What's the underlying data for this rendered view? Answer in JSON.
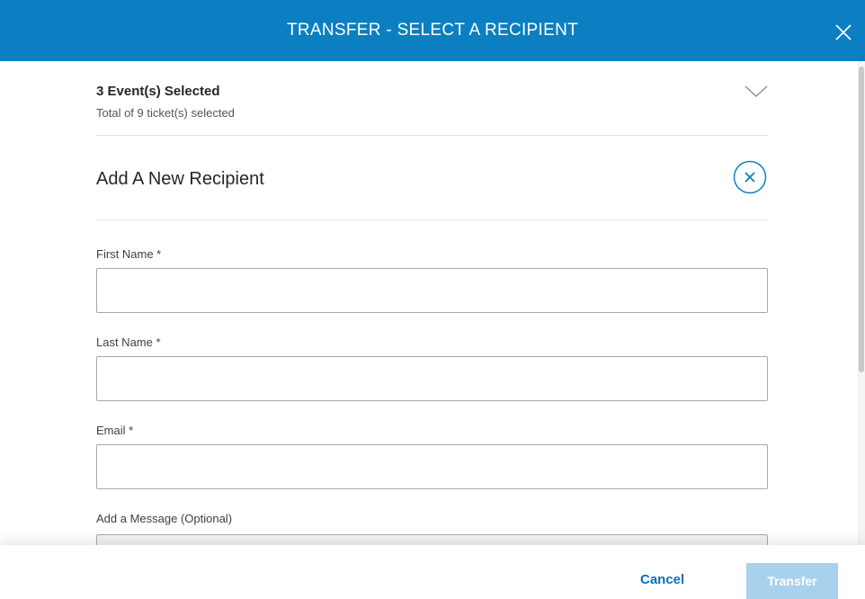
{
  "header": {
    "title": "TRANSFER - SELECT A RECIPIENT",
    "close_icon": "close-icon"
  },
  "events": {
    "title": "3 Event(s) Selected",
    "subtitle": "Total of 9 ticket(s) selected",
    "toggle_icon": "chevron-down-icon"
  },
  "recipient": {
    "title": "Add A New Recipient",
    "remove_icon": "circle-close-icon"
  },
  "form": {
    "first_name_label": "First Name *",
    "first_name_value": "",
    "last_name_label": "Last Name *",
    "last_name_value": "",
    "email_label": "Email *",
    "email_value": "",
    "message_label": "Add a Message (Optional)",
    "message_value": ""
  },
  "footer": {
    "cancel_label": "Cancel",
    "transfer_label": "Transfer"
  },
  "colors": {
    "header_bg": "#0b7fc1",
    "link": "#0b6fb0",
    "transfer_disabled": "#a9d1ee"
  }
}
